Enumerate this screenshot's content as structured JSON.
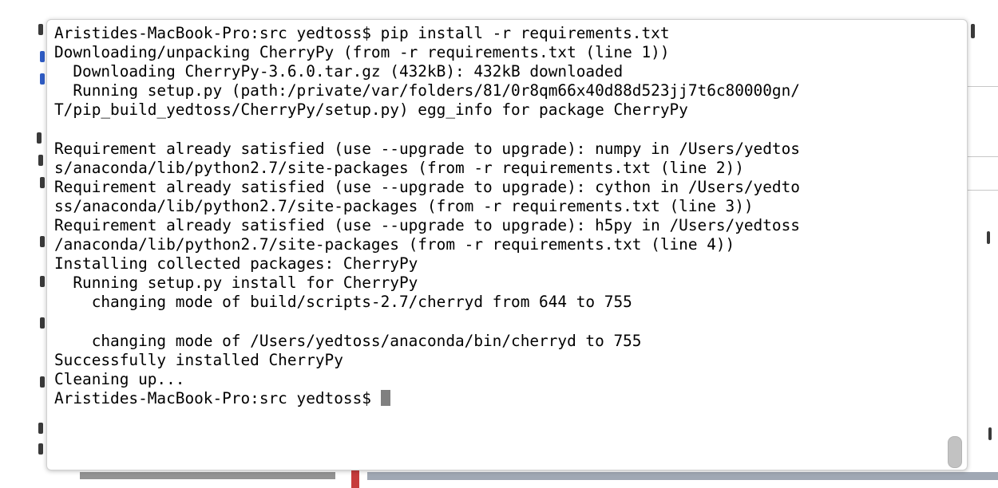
{
  "terminal": {
    "lines": [
      "Aristides-MacBook-Pro:src yedtoss$ pip install -r requirements.txt",
      "Downloading/unpacking CherryPy (from -r requirements.txt (line 1))",
      "  Downloading CherryPy-3.6.0.tar.gz (432kB): 432kB downloaded",
      "  Running setup.py (path:/private/var/folders/81/0r8qm66x40d88d523jj7t6c80000gn/",
      "T/pip_build_yedtoss/CherryPy/setup.py) egg_info for package CherryPy",
      "",
      "Requirement already satisfied (use --upgrade to upgrade): numpy in /Users/yedtos",
      "s/anaconda/lib/python2.7/site-packages (from -r requirements.txt (line 2))",
      "Requirement already satisfied (use --upgrade to upgrade): cython in /Users/yedto",
      "ss/anaconda/lib/python2.7/site-packages (from -r requirements.txt (line 3))",
      "Requirement already satisfied (use --upgrade to upgrade): h5py in /Users/yedtoss",
      "/anaconda/lib/python2.7/site-packages (from -r requirements.txt (line 4))",
      "Installing collected packages: CherryPy",
      "  Running setup.py install for CherryPy",
      "    changing mode of build/scripts-2.7/cherryd from 644 to 755",
      "",
      "    changing mode of /Users/yedtoss/anaconda/bin/cherryd to 755",
      "Successfully installed CherryPy",
      "Cleaning up...",
      "Aristides-MacBook-Pro:src yedtoss$ "
    ],
    "cursor_color": "#808080",
    "text_color": "#000000",
    "background_color": "#ffffff"
  }
}
